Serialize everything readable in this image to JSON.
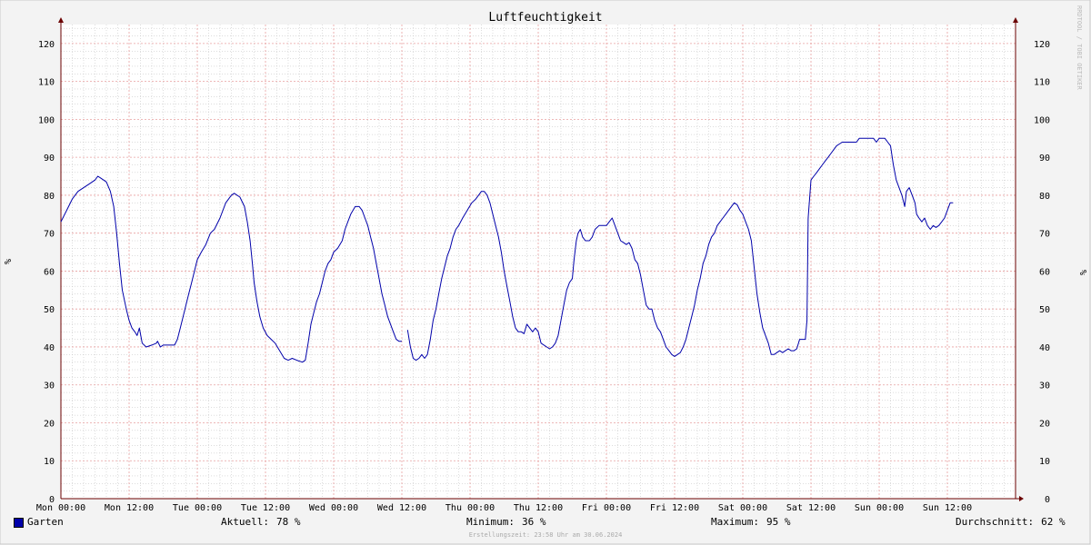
{
  "chart_data": {
    "type": "line",
    "title": "Luftfeuchtigkeit",
    "ylabel": "%",
    "ylim": [
      0,
      125
    ],
    "y_ticks": [
      0,
      10,
      20,
      30,
      40,
      50,
      60,
      70,
      80,
      90,
      100,
      110,
      120
    ],
    "x_ticks": [
      "Mon 00:00",
      "Mon 12:00",
      "Tue 00:00",
      "Tue 12:00",
      "Wed 00:00",
      "Wed 12:00",
      "Thu 00:00",
      "Thu 12:00",
      "Fri 00:00",
      "Fri 12:00",
      "Sat 00:00",
      "Sat 12:00",
      "Sun 00:00",
      "Sun 12:00"
    ],
    "x_unit": "hours since Mon 00:00",
    "xlim": [
      0,
      168
    ],
    "grid": true,
    "series": [
      {
        "name": "Garten",
        "color": "#0000aa",
        "points": [
          [
            0,
            73
          ],
          [
            1,
            76
          ],
          [
            2,
            79
          ],
          [
            3,
            81
          ],
          [
            4,
            82
          ],
          [
            5,
            83
          ],
          [
            6,
            84
          ],
          [
            6.5,
            85
          ],
          [
            7,
            84.5
          ],
          [
            8,
            83.5
          ],
          [
            8.7,
            81
          ],
          [
            9.3,
            77
          ],
          [
            9.8,
            70
          ],
          [
            10.3,
            62
          ],
          [
            10.8,
            55
          ],
          [
            11.5,
            50
          ],
          [
            12,
            47
          ],
          [
            12.5,
            45
          ],
          [
            13,
            44
          ],
          [
            13.4,
            43
          ],
          [
            13.8,
            45
          ],
          [
            14.3,
            41
          ],
          [
            15,
            40
          ],
          [
            16,
            40.5
          ],
          [
            16.8,
            41
          ],
          [
            17,
            41.5
          ],
          [
            17.5,
            40
          ],
          [
            18,
            40.5
          ],
          [
            19,
            40.5
          ],
          [
            20,
            40.5
          ],
          [
            20.5,
            42
          ],
          [
            21,
            45
          ],
          [
            21.5,
            48
          ],
          [
            22,
            51
          ],
          [
            22.5,
            54
          ],
          [
            23,
            57
          ],
          [
            23.5,
            60
          ],
          [
            24,
            63
          ],
          [
            24.7,
            65
          ],
          [
            25.5,
            67
          ],
          [
            26.3,
            70
          ],
          [
            27,
            71
          ],
          [
            28,
            74
          ],
          [
            29,
            78
          ],
          [
            30,
            80
          ],
          [
            30.5,
            80.5
          ],
          [
            31.5,
            79.5
          ],
          [
            32.3,
            77
          ],
          [
            32.8,
            73
          ],
          [
            33.3,
            68
          ],
          [
            33.7,
            62
          ],
          [
            34,
            57
          ],
          [
            34.5,
            52
          ],
          [
            35,
            48
          ],
          [
            35.6,
            45
          ],
          [
            36.3,
            43
          ],
          [
            37,
            42
          ],
          [
            37.7,
            41
          ],
          [
            38.5,
            39
          ],
          [
            39.3,
            37
          ],
          [
            40,
            36.5
          ],
          [
            40.7,
            37
          ],
          [
            41.5,
            36.5
          ],
          [
            42.5,
            36
          ],
          [
            43,
            36.5
          ],
          [
            43.5,
            41
          ],
          [
            44,
            46
          ],
          [
            44.5,
            49
          ],
          [
            45,
            52
          ],
          [
            45.5,
            54
          ],
          [
            46,
            57
          ],
          [
            46.5,
            60
          ],
          [
            47,
            62
          ],
          [
            47.5,
            63
          ],
          [
            48,
            65
          ],
          [
            48.7,
            66
          ],
          [
            49.5,
            68
          ],
          [
            50,
            71
          ],
          [
            50.5,
            73
          ],
          [
            51,
            75
          ],
          [
            51.8,
            77
          ],
          [
            52.5,
            77
          ],
          [
            53,
            76
          ],
          [
            53.5,
            74
          ],
          [
            54,
            72
          ],
          [
            54.5,
            69
          ],
          [
            55,
            66
          ],
          [
            55.5,
            62
          ],
          [
            56,
            58
          ],
          [
            56.5,
            54
          ],
          [
            57,
            51
          ],
          [
            57.5,
            48
          ],
          [
            58,
            46
          ],
          [
            58.5,
            44
          ],
          [
            59,
            42
          ],
          [
            59.5,
            41.5
          ],
          [
            60,
            41.5
          ],
          [
            null,
            null
          ],
          [
            61,
            44.5
          ],
          [
            61.5,
            40
          ],
          [
            62,
            37
          ],
          [
            62.5,
            36.5
          ],
          [
            63,
            37
          ],
          [
            63.5,
            38
          ],
          [
            64,
            37
          ],
          [
            64.5,
            38
          ],
          [
            65,
            42
          ],
          [
            65.5,
            47
          ],
          [
            66,
            50
          ],
          [
            66.5,
            54
          ],
          [
            67,
            58
          ],
          [
            67.5,
            61
          ],
          [
            68,
            64
          ],
          [
            68.5,
            66
          ],
          [
            69,
            69
          ],
          [
            69.5,
            71
          ],
          [
            70,
            72
          ],
          [
            70.7,
            74
          ],
          [
            71.5,
            76
          ],
          [
            72.3,
            78
          ],
          [
            73,
            79
          ],
          [
            73.5,
            80
          ],
          [
            74,
            81
          ],
          [
            74.5,
            81
          ],
          [
            75,
            80
          ],
          [
            75.5,
            78
          ],
          [
            76,
            75
          ],
          [
            76.5,
            72
          ],
          [
            77,
            69
          ],
          [
            77.5,
            65
          ],
          [
            78,
            60
          ],
          [
            78.5,
            56
          ],
          [
            79,
            52
          ],
          [
            79.5,
            48
          ],
          [
            80,
            45
          ],
          [
            80.5,
            44
          ],
          [
            81,
            44
          ],
          [
            81.5,
            43.5
          ],
          [
            82,
            46
          ],
          [
            82.5,
            45
          ],
          [
            83,
            44
          ],
          [
            83.5,
            45
          ],
          [
            84,
            44
          ],
          [
            84.5,
            41
          ],
          [
            85.5,
            40
          ],
          [
            86,
            39.5
          ],
          [
            86.5,
            40
          ],
          [
            87,
            41
          ],
          [
            87.5,
            43
          ],
          [
            88,
            47
          ],
          [
            88.5,
            51
          ],
          [
            89,
            55
          ],
          [
            89.5,
            57
          ],
          [
            90,
            58
          ],
          [
            90.3,
            63
          ],
          [
            90.7,
            68
          ],
          [
            91,
            70
          ],
          [
            91.4,
            71
          ],
          [
            91.8,
            69
          ],
          [
            92.3,
            68
          ],
          [
            93,
            68
          ],
          [
            93.5,
            69
          ],
          [
            94,
            71
          ],
          [
            94.7,
            72
          ],
          [
            95.5,
            72
          ],
          [
            96,
            72
          ],
          [
            96.5,
            73
          ],
          [
            97,
            74
          ],
          [
            97.5,
            72
          ],
          [
            98,
            70
          ],
          [
            98.5,
            68
          ],
          [
            99,
            67.5
          ],
          [
            99.5,
            67
          ],
          [
            100,
            67.5
          ],
          [
            100.5,
            66
          ],
          [
            101,
            63
          ],
          [
            101.5,
            62
          ],
          [
            102,
            59
          ],
          [
            102.5,
            55
          ],
          [
            103,
            51
          ],
          [
            103.5,
            50
          ],
          [
            104,
            50
          ],
          [
            104.5,
            47
          ],
          [
            105,
            45
          ],
          [
            105.5,
            44
          ],
          [
            106,
            42
          ],
          [
            106.5,
            40
          ],
          [
            107,
            39
          ],
          [
            107.5,
            38
          ],
          [
            108,
            37.5
          ],
          [
            108.5,
            38
          ],
          [
            109,
            38.5
          ],
          [
            109.5,
            40
          ],
          [
            110,
            42
          ],
          [
            110.5,
            45
          ],
          [
            111,
            48
          ],
          [
            111.5,
            51
          ],
          [
            112,
            55
          ],
          [
            112.5,
            58
          ],
          [
            113,
            62
          ],
          [
            113.5,
            64
          ],
          [
            114,
            67
          ],
          [
            114.5,
            69
          ],
          [
            115,
            70
          ],
          [
            115.5,
            72
          ],
          [
            116,
            73
          ],
          [
            116.5,
            74
          ],
          [
            117,
            75
          ],
          [
            117.5,
            76
          ],
          [
            118,
            77
          ],
          [
            118.5,
            78
          ],
          [
            119,
            77.5
          ],
          [
            119.5,
            76
          ],
          [
            120,
            75
          ],
          [
            120.5,
            73
          ],
          [
            121,
            71
          ],
          [
            121.5,
            68
          ],
          [
            122,
            61
          ],
          [
            122.5,
            54
          ],
          [
            123,
            49
          ],
          [
            123.5,
            45
          ],
          [
            124,
            43
          ],
          [
            124.5,
            41
          ],
          [
            125,
            38
          ],
          [
            125.5,
            38
          ],
          [
            126,
            38.5
          ],
          [
            126.5,
            39
          ],
          [
            127,
            38.5
          ],
          [
            127.5,
            39
          ],
          [
            128,
            39.5
          ],
          [
            128.5,
            39
          ],
          [
            129,
            39
          ],
          [
            129.5,
            39.5
          ],
          [
            130,
            42
          ],
          [
            130.5,
            42
          ],
          [
            131,
            42
          ],
          [
            131.3,
            47
          ],
          [
            131.5,
            74
          ],
          [
            132,
            84
          ],
          [
            132.5,
            85
          ],
          [
            133,
            86
          ],
          [
            133.5,
            87
          ],
          [
            134,
            88
          ],
          [
            134.5,
            89
          ],
          [
            135,
            90
          ],
          [
            135.5,
            91
          ],
          [
            136,
            92
          ],
          [
            136.5,
            93
          ],
          [
            137,
            93.5
          ],
          [
            137.5,
            94
          ],
          [
            138,
            94
          ],
          [
            139,
            94
          ],
          [
            140,
            94
          ],
          [
            140.5,
            95
          ],
          [
            141,
            95
          ],
          [
            142,
            95
          ],
          [
            143,
            95
          ],
          [
            143.5,
            94
          ],
          [
            144,
            95
          ],
          [
            145,
            95
          ],
          [
            145.5,
            94
          ],
          [
            146,
            93
          ],
          [
            146.5,
            88
          ],
          [
            147,
            84
          ],
          [
            147.5,
            82
          ],
          [
            148,
            80
          ],
          [
            148.5,
            77
          ],
          [
            148.8,
            81
          ],
          [
            149.3,
            82
          ],
          [
            149.8,
            80
          ],
          [
            150.3,
            78
          ],
          [
            150.6,
            75
          ],
          [
            151,
            74
          ],
          [
            151.5,
            73
          ],
          [
            152,
            74
          ],
          [
            152.5,
            72
          ],
          [
            153,
            71
          ],
          [
            153.5,
            72
          ],
          [
            154,
            71.5
          ],
          [
            154.5,
            72
          ],
          [
            155,
            73
          ],
          [
            155.5,
            74
          ],
          [
            156,
            76
          ],
          [
            156.5,
            78
          ],
          [
            157,
            78
          ]
        ]
      }
    ],
    "stats": {
      "current": "78 %",
      "minimum": "36 %",
      "maximum": "95 %",
      "average": "62 %"
    }
  },
  "legend": {
    "series_label": "Garten",
    "current_label": "Aktuell:",
    "current_value": "78 %",
    "min_label": "Minimum:",
    "min_value": "36 %",
    "max_label": "Maximum:",
    "max_value": "95 %",
    "avg_label": "Durchschnitt:",
    "avg_value": "62 %"
  },
  "footer": {
    "timestamp": "Erstellungszeit: 23:58 Uhr am 30.06.2024"
  },
  "watermark": "RRDTOOL / TOBI OETIKER",
  "colors": {
    "line": "#0000aa",
    "major_grid": "#e8a0a0",
    "minor_grid": "#bbbbbb",
    "axis": "#6b0000",
    "background": "#f3f3f3",
    "plot_background": "#ffffff"
  }
}
